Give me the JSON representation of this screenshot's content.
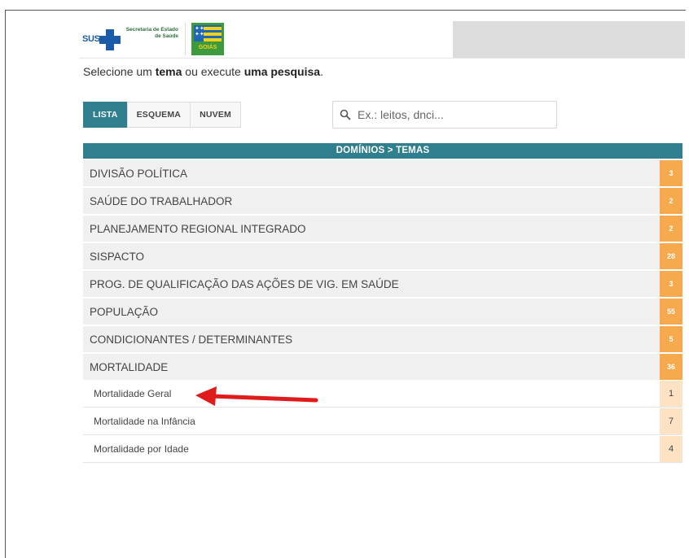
{
  "header": {
    "sus_label": "SUS",
    "secretaria_label": "Secretaria de Estado de Saúde",
    "goias_label": "GOIÁS"
  },
  "instruction": {
    "prefix": "Selecione um ",
    "tema": "tema",
    "middle": " ou execute ",
    "pesquisa": "uma pesquisa",
    "suffix": "."
  },
  "tabs": [
    {
      "label": "LISTA",
      "active": true
    },
    {
      "label": "ESQUEMA",
      "active": false
    },
    {
      "label": "NUVEM",
      "active": false
    }
  ],
  "search": {
    "placeholder": "Ex.: leitos, dnci...",
    "value": ""
  },
  "table": {
    "header": "DOMÍNIOS > TEMAS",
    "rows": [
      {
        "label": "DIVISÃO POLÍTICA",
        "count": "3"
      },
      {
        "label": "SAÚDE DO TRABALHADOR",
        "count": "2"
      },
      {
        "label": "PLANEJAMENTO REGIONAL INTEGRADO",
        "count": "2"
      },
      {
        "label": "SISPACTO",
        "count": "28"
      },
      {
        "label": "PROG. DE QUALIFICAÇÃO DAS AÇÕES DE VIG. EM SAÚDE",
        "count": "3"
      },
      {
        "label": "POPULAÇÃO",
        "count": "55"
      },
      {
        "label": "CONDICIONANTES / DETERMINANTES",
        "count": "5"
      },
      {
        "label": "MORTALIDADE",
        "count": "36"
      }
    ],
    "subrows": [
      {
        "label": "Mortalidade Geral",
        "count": "1"
      },
      {
        "label": "Mortalidade na Infância",
        "count": "7"
      },
      {
        "label": "Mortalidade por Idade",
        "count": "4"
      }
    ]
  },
  "colors": {
    "accent": "#2f7f8f",
    "badge": "#f6a94d",
    "badge_light": "#fde3c3",
    "arrow": "#e01b1b"
  },
  "icons": {
    "search": "search-icon",
    "arrow": "arrow-left-icon"
  }
}
